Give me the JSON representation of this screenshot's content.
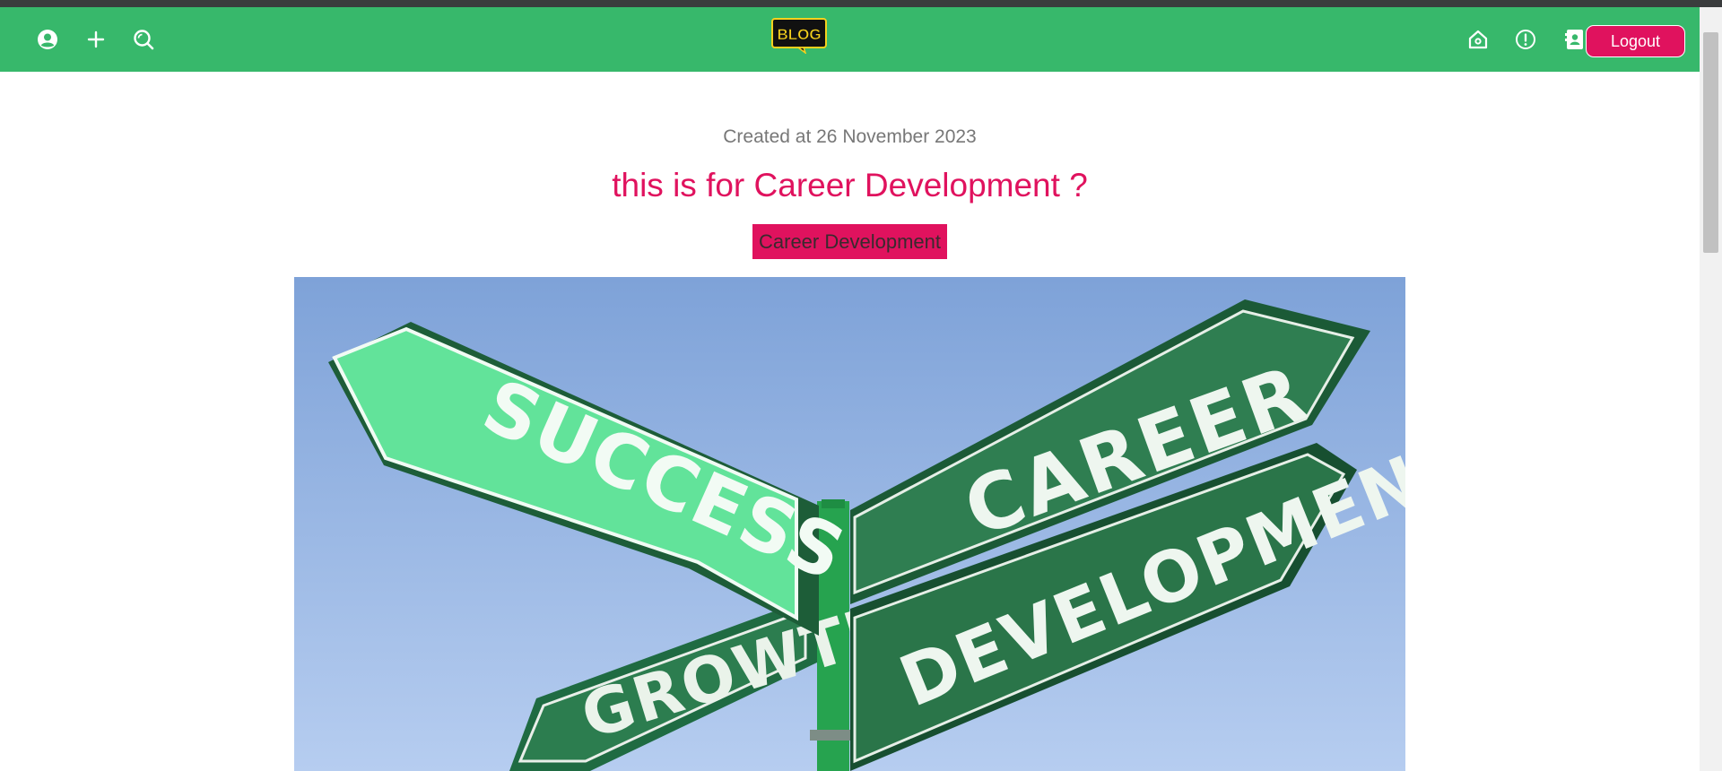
{
  "navbar": {
    "left_icons": [
      "user-circle-icon",
      "plus-icon",
      "search-icon"
    ],
    "logo_text": "BLOG",
    "right_icons": [
      "home-icon",
      "info-icon",
      "contact-card-icon"
    ],
    "logout_label": "Logout",
    "colors": {
      "bar": "#37b86b",
      "accent": "#e0125e",
      "logo_bg": "#111111",
      "logo_text": "#f5d11d"
    }
  },
  "post": {
    "created": "Created at 26 November 2023",
    "title": "this is for Career Development ?",
    "category": "Career Development",
    "image": {
      "signs": [
        "SUCCESS",
        "CAREER",
        "GROWTH",
        "DEVELOPMENT"
      ]
    }
  }
}
